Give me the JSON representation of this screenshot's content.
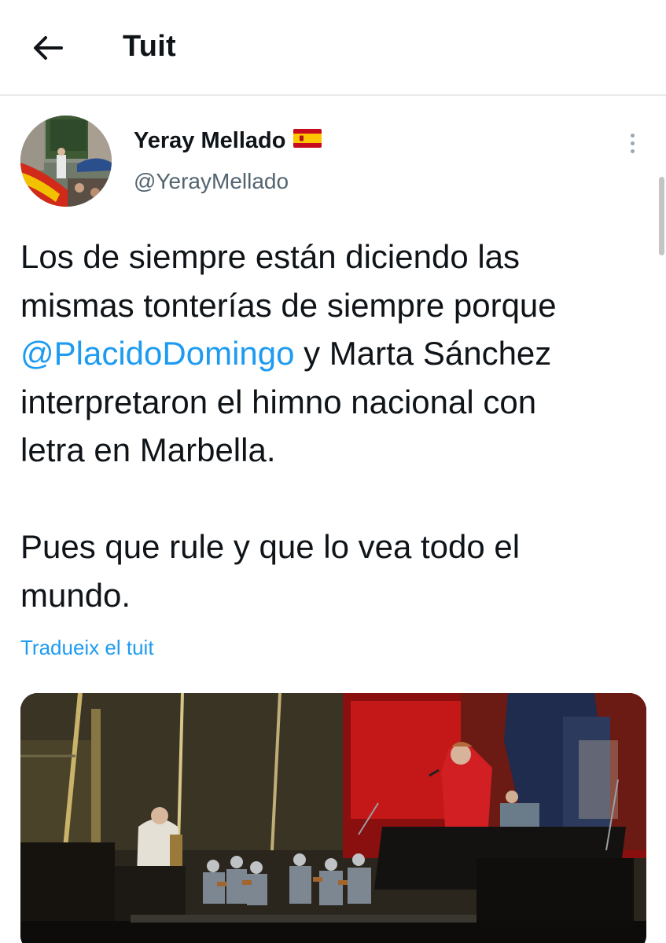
{
  "header": {
    "back_icon": "arrow-left-icon",
    "title": "Tuit"
  },
  "tweet": {
    "author": {
      "display_name": "Yeray Mellado",
      "flag_icon": "spain-flag-icon",
      "handle": "@YerayMellado"
    },
    "more_icon": "more-vertical-icon",
    "text_before_mention": "Los de siempre están diciendo las\nmismas tonterías de siempre porque\n",
    "mention": "@PlacidoDomingo",
    "text_after_mention": " y Marta Sánchez\ninterpretaron el himno nacional con\nletra en Marbella.\n\nPues que rule y que lo vea todo el\nmundo.",
    "translate_label": "Tradueix el tuit"
  },
  "colors": {
    "text": "#0f1419",
    "secondary_text": "#536471",
    "link": "#1d9bf0",
    "divider": "#e7e9ea"
  }
}
